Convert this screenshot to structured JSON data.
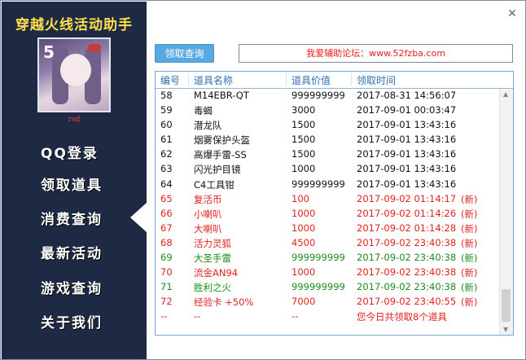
{
  "app": {
    "title": "穿越火线活动助手",
    "username": "rsd",
    "avatar_badge": "5"
  },
  "nav": [
    {
      "label": "QQ登录"
    },
    {
      "label": "领取道具"
    },
    {
      "label": "消费查询"
    },
    {
      "label": "最新活动"
    },
    {
      "label": "游戏查询"
    },
    {
      "label": "关于我们"
    }
  ],
  "active_nav_index": 2,
  "toolbar": {
    "query_button": "领取查询",
    "forum_text": "我爱辅助论坛：www.52fzba.com"
  },
  "table": {
    "columns": [
      "编号",
      "道具名称",
      "道具价值",
      "领取时间"
    ],
    "rows": [
      {
        "id": "58",
        "name": "M14EBR-QT",
        "value": "999999999",
        "time": "2017-08-31 14:56:07",
        "tag": "",
        "color": "#111111"
      },
      {
        "id": "59",
        "name": "毒蝎",
        "value": "3000",
        "time": "2017-09-01 00:03:47",
        "tag": "",
        "color": "#111111"
      },
      {
        "id": "60",
        "name": "潜龙队",
        "value": "1500",
        "time": "2017-09-01 13:43:16",
        "tag": "",
        "color": "#111111"
      },
      {
        "id": "61",
        "name": "烟雾保护头盔",
        "value": "1500",
        "time": "2017-09-01 13:43:16",
        "tag": "",
        "color": "#111111"
      },
      {
        "id": "62",
        "name": "高爆手雷-SS",
        "value": "1500",
        "time": "2017-09-01 13:43:16",
        "tag": "",
        "color": "#111111"
      },
      {
        "id": "63",
        "name": "闪光护目镜",
        "value": "1000",
        "time": "2017-09-01 13:43:16",
        "tag": "",
        "color": "#111111"
      },
      {
        "id": "64",
        "name": "C4工具钳",
        "value": "999999999",
        "time": "2017-09-01 13:43:16",
        "tag": "",
        "color": "#111111"
      },
      {
        "id": "65",
        "name": "复活币",
        "value": "100",
        "time": "2017-09-02 01:14:17",
        "tag": "(新)",
        "color": "#e0221f"
      },
      {
        "id": "66",
        "name": "小喇叭",
        "value": "1000",
        "time": "2017-09-02 01:14:26",
        "tag": "(新)",
        "color": "#e0221f"
      },
      {
        "id": "67",
        "name": "大喇叭",
        "value": "1000",
        "time": "2017-09-02 01:14:28",
        "tag": "(新)",
        "color": "#e0221f"
      },
      {
        "id": "68",
        "name": "活力灵狐",
        "value": "4500",
        "time": "2017-09-02 23:40:38",
        "tag": "(新)",
        "color": "#e0221f"
      },
      {
        "id": "69",
        "name": "大圣手雷",
        "value": "999999999",
        "time": "2017-09-02 23:40:38",
        "tag": "(新)",
        "color": "#1f8a1f"
      },
      {
        "id": "70",
        "name": "流金AN94",
        "value": "1000",
        "time": "2017-09-02 23:40:38",
        "tag": "(新)",
        "color": "#e0221f"
      },
      {
        "id": "71",
        "name": "胜利之火",
        "value": "999999999",
        "time": "2017-09-02 23:40:38",
        "tag": "(新)",
        "color": "#1f8a1f"
      },
      {
        "id": "72",
        "name": "经验卡 +50%",
        "value": "7000",
        "time": "2017-09-02 23:40:55",
        "tag": "(新)",
        "color": "#e0221f"
      },
      {
        "id": "--",
        "name": "--",
        "value": "--",
        "time": "您今日共领取8个道具",
        "tag": "",
        "color": "#e0221f"
      }
    ]
  },
  "colors": {
    "sidebar_bg": "#1e2a44",
    "title_yellow": "#ffe04a",
    "accent_blue": "#5aa8e0",
    "header_blue": "#2f6fb5"
  }
}
